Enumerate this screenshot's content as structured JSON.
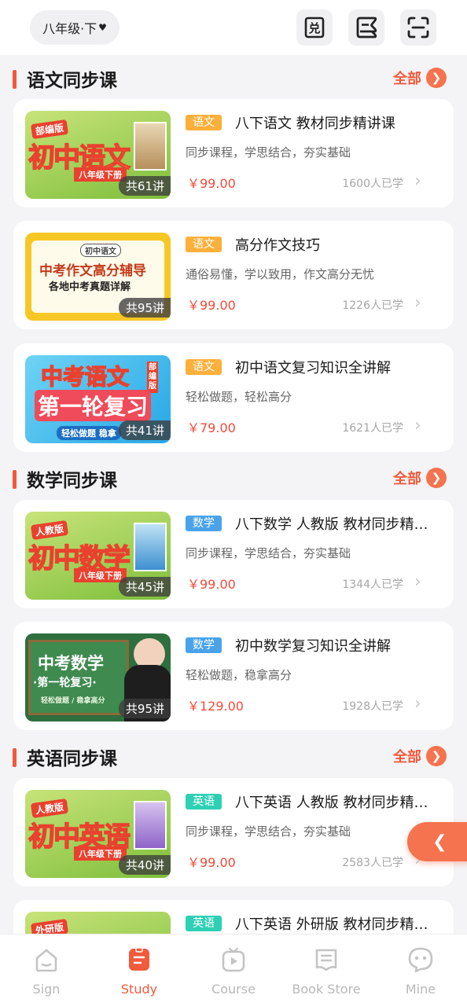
{
  "header": {
    "grade_label": "八年级·下",
    "caret": "♥",
    "redeem_icon_text": "兑",
    "icons": [
      "redeem-icon",
      "schedule-icon",
      "scan-icon"
    ]
  },
  "sections": [
    {
      "title": "语文同步课",
      "all_label": "全部",
      "courses": [
        {
          "tag": "语文",
          "title": "八下语文 教材同步精讲课",
          "subtitle": "同步课程，学思结合，夯实基础",
          "price": "￥99.00",
          "students": "1600人已学",
          "lessons": "共61讲",
          "cover_badge": "部编版",
          "cover_title": "初中语文",
          "cover_sub": "八年级下册"
        },
        {
          "tag": "语文",
          "title": "高分作文技巧",
          "subtitle": "通俗易懂，学以致用，作文高分无忧",
          "price": "￥99.00",
          "students": "1226人已学",
          "lessons": "共95讲",
          "cover_badge": "初中语文",
          "cover_title": "中考作文高分辅导",
          "cover_sub": "各地中考真题详解"
        },
        {
          "tag": "语文",
          "title": "初中语文复习知识全讲解",
          "subtitle": "轻松做题，轻松高分",
          "price": "￥79.00",
          "students": "1621人已学",
          "lessons": "共41讲",
          "cover_badge": "部编版",
          "cover_title": "中考语文",
          "cover_sub": "第一轮复习",
          "cover_note": "轻松做题 稳拿"
        }
      ]
    },
    {
      "title": "数学同步课",
      "all_label": "全部",
      "courses": [
        {
          "tag": "数学",
          "title": "八下数学 人教版 教材同步精讲课",
          "subtitle": "同步课程，学思结合，夯实基础",
          "price": "￥99.00",
          "students": "1344人已学",
          "lessons": "共45讲",
          "cover_badge": "人教版",
          "cover_title": "初中数学",
          "cover_sub": "八年级下册"
        },
        {
          "tag": "数学",
          "title": "初中数学复习知识全讲解",
          "subtitle": "轻松做题，稳拿高分",
          "price": "￥129.00",
          "students": "1928人已学",
          "lessons": "共95讲",
          "cover_title": "中考数学",
          "cover_sub": "·第一轮复习·",
          "cover_note": "轻松做题 / 稳拿高分"
        }
      ]
    },
    {
      "title": "英语同步课",
      "all_label": "全部",
      "courses": [
        {
          "tag": "英语",
          "title": "八下英语 人教版 教材同步精讲课",
          "subtitle": "同步课程，学思结合，夯实基础",
          "price": "￥99.00",
          "students": "2583人已学",
          "lessons": "共40讲",
          "cover_badge": "人教版",
          "cover_title": "初中英语",
          "cover_sub": "八年级下册"
        },
        {
          "tag": "英语",
          "title": "八下英语 外研版 教材同步精讲课",
          "cover_badge": "外研版"
        }
      ]
    }
  ],
  "colors": {
    "accent": "#f25a3c",
    "tag_chinese": "#fbb03b",
    "tag_math": "#4aa3ea",
    "tag_english": "#2ed0b4",
    "price": "#f04a3a"
  },
  "tabbar": {
    "items": [
      {
        "label": "Sign",
        "icon": "home-icon",
        "active": false
      },
      {
        "label": "Study",
        "icon": "study-icon",
        "active": true
      },
      {
        "label": "Course",
        "icon": "course-play-icon",
        "active": false
      },
      {
        "label": "Book Store",
        "icon": "book-store-icon",
        "active": false
      },
      {
        "label": "Mine",
        "icon": "mine-face-icon",
        "active": false
      }
    ]
  }
}
